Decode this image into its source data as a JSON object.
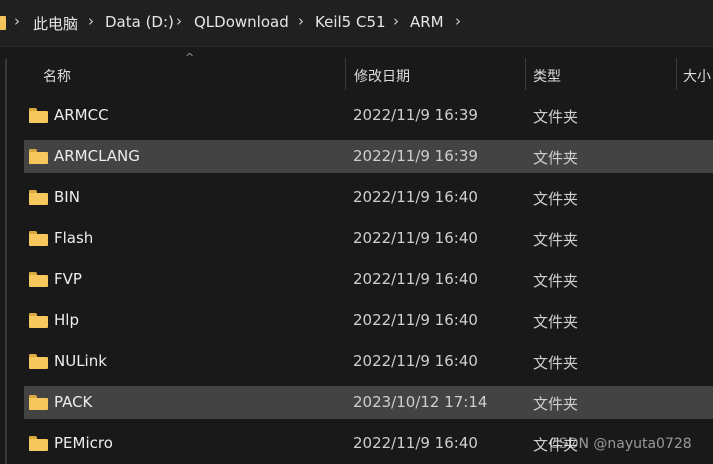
{
  "address": {
    "crumbs": [
      "此电脑",
      "Data (D:)",
      "QLDownload",
      "Keil5 C51",
      "ARM"
    ]
  },
  "columns": {
    "name": "名称",
    "date": "修改日期",
    "type": "类型",
    "size": "大小"
  },
  "rows": [
    {
      "name": "ARMCC",
      "date": "2022/11/9 16:39",
      "type": "文件夹",
      "selected": false
    },
    {
      "name": "ARMCLANG",
      "date": "2022/11/9 16:39",
      "type": "文件夹",
      "selected": true
    },
    {
      "name": "BIN",
      "date": "2022/11/9 16:40",
      "type": "文件夹",
      "selected": false
    },
    {
      "name": "Flash",
      "date": "2022/11/9 16:40",
      "type": "文件夹",
      "selected": false
    },
    {
      "name": "FVP",
      "date": "2022/11/9 16:40",
      "type": "文件夹",
      "selected": false
    },
    {
      "name": "Hlp",
      "date": "2022/11/9 16:40",
      "type": "文件夹",
      "selected": false
    },
    {
      "name": "NULink",
      "date": "2022/11/9 16:40",
      "type": "文件夹",
      "selected": false
    },
    {
      "name": "PACK",
      "date": "2023/10/12 17:14",
      "type": "文件夹",
      "selected": true
    },
    {
      "name": "PEMicro",
      "date": "2022/11/9 16:40",
      "type": "文件夹",
      "selected": false
    }
  ],
  "watermark": "CSDN @nayuta0728",
  "colors": {
    "background": "#191919",
    "selected_row": "#434343",
    "folder": "#f5c75d"
  },
  "icons": {
    "folder": "folder-icon",
    "separator": "chevron-right-icon",
    "sort": "sort-up-icon"
  }
}
